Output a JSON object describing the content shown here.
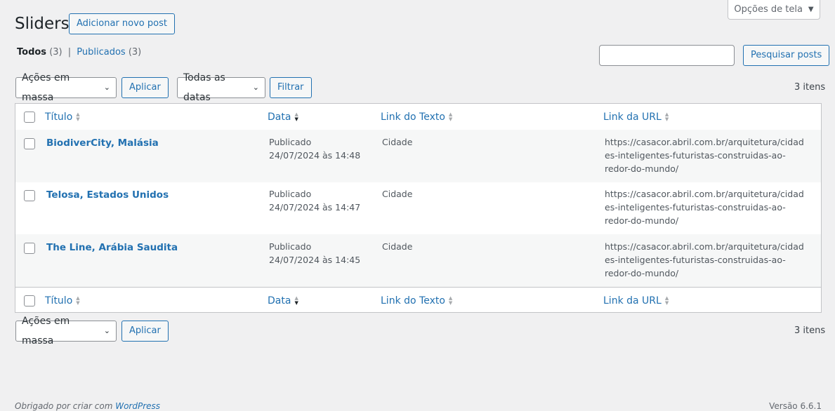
{
  "screen_options": {
    "label": "Opções de tela"
  },
  "header": {
    "title": "Sliders",
    "add_new_label": "Adicionar novo post"
  },
  "views": {
    "all_label": "Todos",
    "all_count": "(3)",
    "separator": "|",
    "published_label": "Publicados",
    "published_count": "(3)"
  },
  "search": {
    "value": "",
    "button_label": "Pesquisar posts"
  },
  "top_nav": {
    "bulk_select": "Ações em massa",
    "apply_label": "Aplicar",
    "dates_select": "Todas as datas",
    "filter_label": "Filtrar",
    "items_count": "3 itens"
  },
  "table": {
    "columns": [
      "Título",
      "Data",
      "Link do Texto",
      "Link da URL"
    ],
    "rows": [
      {
        "title": "BiodiverCity, Malásia",
        "status": "Publicado",
        "date": "24/07/2024 às 14:48",
        "link_text": "Cidade",
        "link_url": "https://casacor.abril.com.br/arquitetura/cidades-inteligentes-futuristas-construidas-ao-redor-do-mundo/"
      },
      {
        "title": "Telosa, Estados Unidos",
        "status": "Publicado",
        "date": "24/07/2024 às 14:47",
        "link_text": "Cidade",
        "link_url": "https://casacor.abril.com.br/arquitetura/cidades-inteligentes-futuristas-construidas-ao-redor-do-mundo/"
      },
      {
        "title": "The Line, Arábia Saudita",
        "status": "Publicado",
        "date": "24/07/2024 às 14:45",
        "link_text": "Cidade",
        "link_url": "https://casacor.abril.com.br/arquitetura/cidades-inteligentes-futuristas-construidas-ao-redor-do-mundo/"
      }
    ]
  },
  "bottom_nav": {
    "bulk_select": "Ações em massa",
    "apply_label": "Aplicar",
    "items_count": "3 itens"
  },
  "footer": {
    "left_prefix": "Obrigado por criar com ",
    "left_link": "WordPress",
    "right": "Versão 6.6.1"
  },
  "icons": {
    "screen_options_caret": "triangle-down-icon",
    "select_chevron": "chevron-down-icon",
    "sort": "sort-icon"
  },
  "colors": {
    "link": "#2271b1",
    "background": "#f0f0f1",
    "border": "#c3c4c7"
  }
}
